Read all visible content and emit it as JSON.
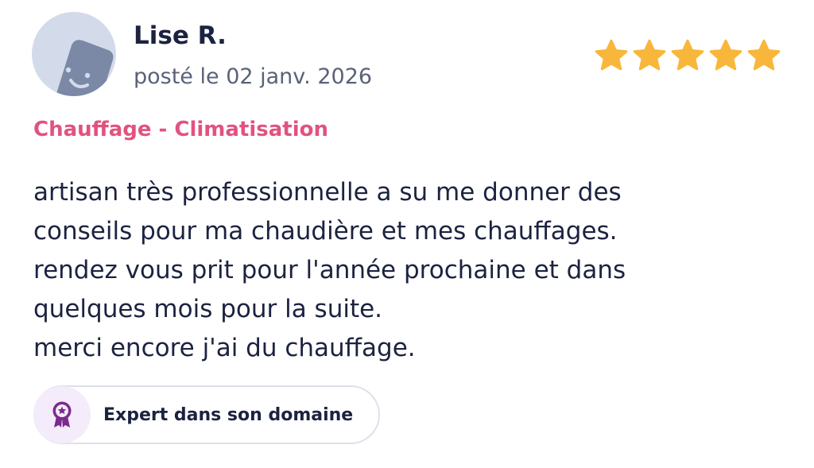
{
  "review": {
    "author": "Lise R.",
    "posted": "posté le 02 janv. 2026",
    "rating": 5,
    "rating_max": 5,
    "category": "Chauffage - Climatisation",
    "text_lines": [
      "artisan très professionnelle a su me donner des",
      "conseils pour ma chaudière et mes chauffages.",
      "rendez vous prit pour l'année prochaine et dans",
      "quelques mois pour la suite.",
      "merci encore j'ai du chauffage."
    ],
    "badge": {
      "label": "Expert dans son domaine",
      "icon": "award-ribbon-icon"
    }
  },
  "icons": {
    "avatar": "smiley-avatar-icon",
    "star": "star-icon"
  },
  "colors": {
    "star": "#f8b73b",
    "category": "#e2527f",
    "text": "#1c2340",
    "meta": "#5a6278",
    "avatar_bg": "#d3dbea",
    "avatar_face": "#7b88a6",
    "badge_icon": "#7b2a8e",
    "badge_icon_bg": "#f4ecfa"
  }
}
